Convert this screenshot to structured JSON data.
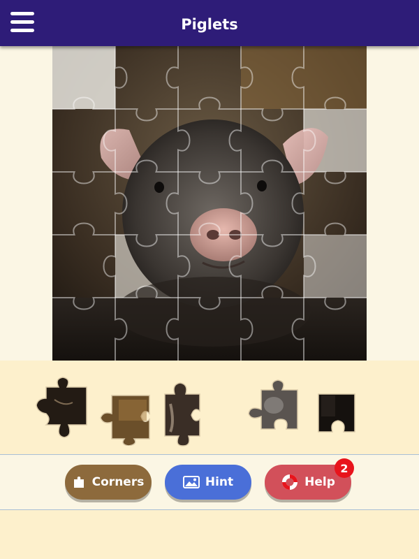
{
  "header": {
    "title": "Piglets",
    "menu_icon": "hamburger-menu-icon"
  },
  "colors": {
    "header": "#2e1c78",
    "background": "#fbf6e4",
    "tray": "#fdf0cc",
    "corners_button": "#8d6a3c",
    "hint_button": "#4a6fd8",
    "help_button": "#d2505a",
    "badge": "#e8141c"
  },
  "puzzle": {
    "image_subject": "piglet",
    "grid": {
      "rows": 5,
      "cols": 5
    },
    "tray_piece_count": 5
  },
  "toolbar": {
    "corners": {
      "label": "Corners",
      "icon": "puzzle-piece-icon"
    },
    "hint": {
      "label": "Hint",
      "icon": "picture-icon"
    },
    "help": {
      "label": "Help",
      "icon": "lifebuoy-icon",
      "badge": "2"
    }
  }
}
